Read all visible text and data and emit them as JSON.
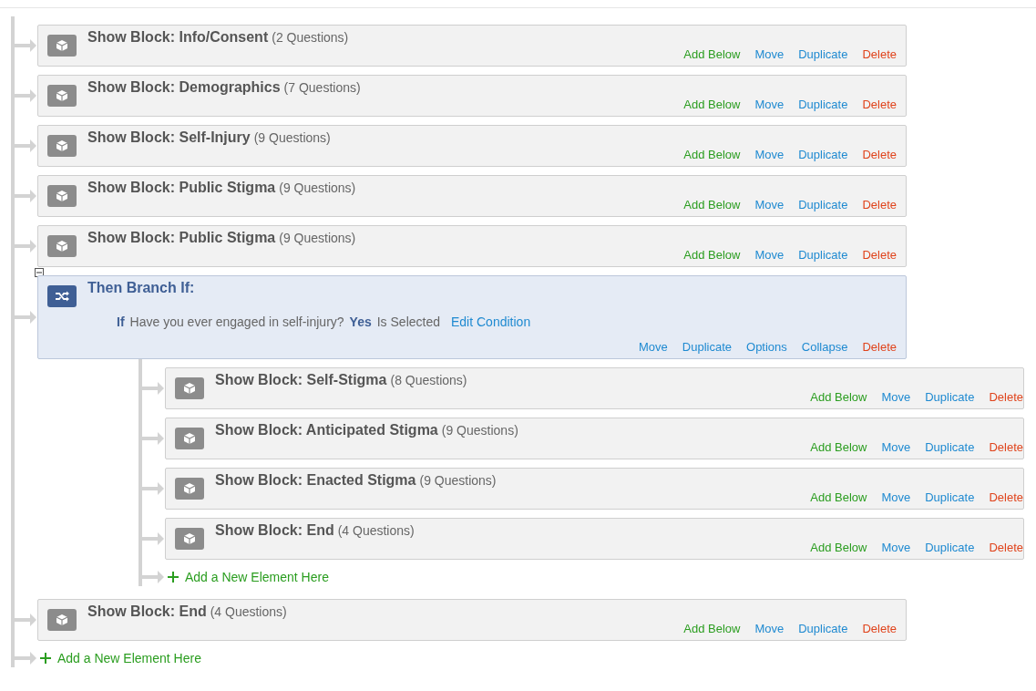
{
  "flow": [
    {
      "kind": "block",
      "title": "Show Block: Info/Consent",
      "count": "(2 Questions)",
      "actions": [
        {
          "label": "Add Below",
          "kind": "add"
        },
        {
          "label": "Move",
          "kind": "link"
        },
        {
          "label": "Duplicate",
          "kind": "link"
        },
        {
          "label": "Delete",
          "kind": "delete"
        }
      ]
    },
    {
      "kind": "block",
      "title": "Show Block: Demographics",
      "count": "(7 Questions)",
      "actions": [
        {
          "label": "Add Below",
          "kind": "add"
        },
        {
          "label": "Move",
          "kind": "link"
        },
        {
          "label": "Duplicate",
          "kind": "link"
        },
        {
          "label": "Delete",
          "kind": "delete"
        }
      ]
    },
    {
      "kind": "block",
      "title": "Show Block: Self-Injury",
      "count": "(9 Questions)",
      "actions": [
        {
          "label": "Add Below",
          "kind": "add"
        },
        {
          "label": "Move",
          "kind": "link"
        },
        {
          "label": "Duplicate",
          "kind": "link"
        },
        {
          "label": "Delete",
          "kind": "delete"
        }
      ]
    },
    {
      "kind": "block",
      "title": "Show Block: Public Stigma",
      "count": "(9 Questions)",
      "actions": [
        {
          "label": "Add Below",
          "kind": "add"
        },
        {
          "label": "Move",
          "kind": "link"
        },
        {
          "label": "Duplicate",
          "kind": "link"
        },
        {
          "label": "Delete",
          "kind": "delete"
        }
      ]
    },
    {
      "kind": "block",
      "title": "Show Block: Public Stigma",
      "count": "(9 Questions)",
      "actions": [
        {
          "label": "Add Below",
          "kind": "add"
        },
        {
          "label": "Move",
          "kind": "link"
        },
        {
          "label": "Duplicate",
          "kind": "link"
        },
        {
          "label": "Delete",
          "kind": "delete"
        }
      ]
    },
    {
      "kind": "branch",
      "title": "Then Branch If:",
      "expanded": true,
      "condition": {
        "if": "If",
        "question": "Have you ever engaged in self-injury?",
        "answer": "Yes",
        "operator": "Is Selected",
        "edit": "Edit Condition"
      },
      "actions": [
        {
          "label": "Move",
          "kind": "link"
        },
        {
          "label": "Duplicate",
          "kind": "link"
        },
        {
          "label": "Options",
          "kind": "link"
        },
        {
          "label": "Collapse",
          "kind": "link"
        },
        {
          "label": "Delete",
          "kind": "delete"
        }
      ],
      "children": [
        {
          "kind": "block",
          "title": "Show Block: Self-Stigma",
          "count": "(8 Questions)",
          "actions": [
            {
              "label": "Add Below",
              "kind": "add"
            },
            {
              "label": "Move",
              "kind": "link"
            },
            {
              "label": "Duplicate",
              "kind": "link"
            },
            {
              "label": "Delete",
              "kind": "delete"
            }
          ]
        },
        {
          "kind": "block",
          "title": "Show Block: Anticipated Stigma",
          "count": "(9 Questions)",
          "actions": [
            {
              "label": "Add Below",
              "kind": "add"
            },
            {
              "label": "Move",
              "kind": "link"
            },
            {
              "label": "Duplicate",
              "kind": "link"
            },
            {
              "label": "Delete",
              "kind": "delete"
            }
          ]
        },
        {
          "kind": "block",
          "title": "Show Block: Enacted Stigma",
          "count": "(9 Questions)",
          "actions": [
            {
              "label": "Add Below",
              "kind": "add"
            },
            {
              "label": "Move",
              "kind": "link"
            },
            {
              "label": "Duplicate",
              "kind": "link"
            },
            {
              "label": "Delete",
              "kind": "delete"
            }
          ]
        },
        {
          "kind": "block",
          "title": "Show Block: End",
          "count": "(4 Questions)",
          "actions": [
            {
              "label": "Add Below",
              "kind": "add"
            },
            {
              "label": "Move",
              "kind": "link"
            },
            {
              "label": "Duplicate",
              "kind": "link"
            },
            {
              "label": "Delete",
              "kind": "delete"
            }
          ]
        },
        {
          "kind": "add",
          "label": "Add a New Element Here"
        }
      ]
    },
    {
      "kind": "block",
      "title": "Show Block: End",
      "count": "(4 Questions)",
      "actions": [
        {
          "label": "Add Below",
          "kind": "add"
        },
        {
          "label": "Move",
          "kind": "link"
        },
        {
          "label": "Duplicate",
          "kind": "link"
        },
        {
          "label": "Delete",
          "kind": "delete"
        }
      ]
    },
    {
      "kind": "add",
      "label": "Add a New Element Here"
    }
  ]
}
